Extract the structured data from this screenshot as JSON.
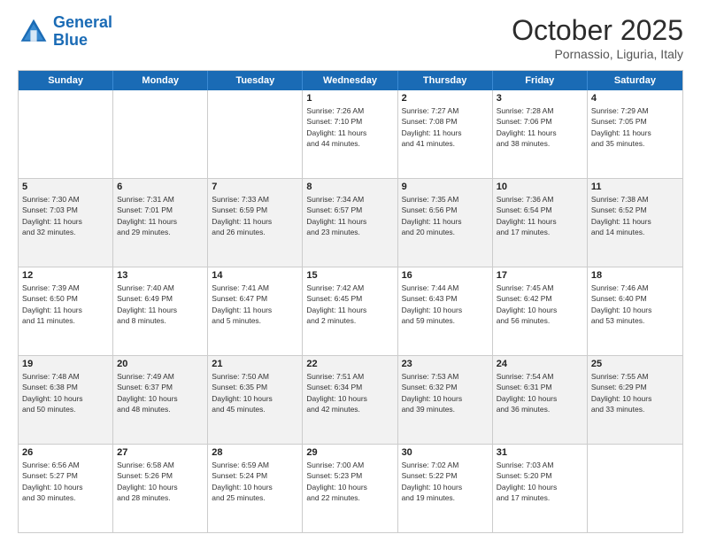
{
  "header": {
    "logo_general": "General",
    "logo_blue": "Blue",
    "month": "October 2025",
    "location": "Pornassio, Liguria, Italy"
  },
  "days_of_week": [
    "Sunday",
    "Monday",
    "Tuesday",
    "Wednesday",
    "Thursday",
    "Friday",
    "Saturday"
  ],
  "rows": [
    {
      "alt": false,
      "cells": [
        {
          "day": "",
          "lines": []
        },
        {
          "day": "",
          "lines": []
        },
        {
          "day": "",
          "lines": []
        },
        {
          "day": "1",
          "lines": [
            "Sunrise: 7:26 AM",
            "Sunset: 7:10 PM",
            "Daylight: 11 hours",
            "and 44 minutes."
          ]
        },
        {
          "day": "2",
          "lines": [
            "Sunrise: 7:27 AM",
            "Sunset: 7:08 PM",
            "Daylight: 11 hours",
            "and 41 minutes."
          ]
        },
        {
          "day": "3",
          "lines": [
            "Sunrise: 7:28 AM",
            "Sunset: 7:06 PM",
            "Daylight: 11 hours",
            "and 38 minutes."
          ]
        },
        {
          "day": "4",
          "lines": [
            "Sunrise: 7:29 AM",
            "Sunset: 7:05 PM",
            "Daylight: 11 hours",
            "and 35 minutes."
          ]
        }
      ]
    },
    {
      "alt": true,
      "cells": [
        {
          "day": "5",
          "lines": [
            "Sunrise: 7:30 AM",
            "Sunset: 7:03 PM",
            "Daylight: 11 hours",
            "and 32 minutes."
          ]
        },
        {
          "day": "6",
          "lines": [
            "Sunrise: 7:31 AM",
            "Sunset: 7:01 PM",
            "Daylight: 11 hours",
            "and 29 minutes."
          ]
        },
        {
          "day": "7",
          "lines": [
            "Sunrise: 7:33 AM",
            "Sunset: 6:59 PM",
            "Daylight: 11 hours",
            "and 26 minutes."
          ]
        },
        {
          "day": "8",
          "lines": [
            "Sunrise: 7:34 AM",
            "Sunset: 6:57 PM",
            "Daylight: 11 hours",
            "and 23 minutes."
          ]
        },
        {
          "day": "9",
          "lines": [
            "Sunrise: 7:35 AM",
            "Sunset: 6:56 PM",
            "Daylight: 11 hours",
            "and 20 minutes."
          ]
        },
        {
          "day": "10",
          "lines": [
            "Sunrise: 7:36 AM",
            "Sunset: 6:54 PM",
            "Daylight: 11 hours",
            "and 17 minutes."
          ]
        },
        {
          "day": "11",
          "lines": [
            "Sunrise: 7:38 AM",
            "Sunset: 6:52 PM",
            "Daylight: 11 hours",
            "and 14 minutes."
          ]
        }
      ]
    },
    {
      "alt": false,
      "cells": [
        {
          "day": "12",
          "lines": [
            "Sunrise: 7:39 AM",
            "Sunset: 6:50 PM",
            "Daylight: 11 hours",
            "and 11 minutes."
          ]
        },
        {
          "day": "13",
          "lines": [
            "Sunrise: 7:40 AM",
            "Sunset: 6:49 PM",
            "Daylight: 11 hours",
            "and 8 minutes."
          ]
        },
        {
          "day": "14",
          "lines": [
            "Sunrise: 7:41 AM",
            "Sunset: 6:47 PM",
            "Daylight: 11 hours",
            "and 5 minutes."
          ]
        },
        {
          "day": "15",
          "lines": [
            "Sunrise: 7:42 AM",
            "Sunset: 6:45 PM",
            "Daylight: 11 hours",
            "and 2 minutes."
          ]
        },
        {
          "day": "16",
          "lines": [
            "Sunrise: 7:44 AM",
            "Sunset: 6:43 PM",
            "Daylight: 10 hours",
            "and 59 minutes."
          ]
        },
        {
          "day": "17",
          "lines": [
            "Sunrise: 7:45 AM",
            "Sunset: 6:42 PM",
            "Daylight: 10 hours",
            "and 56 minutes."
          ]
        },
        {
          "day": "18",
          "lines": [
            "Sunrise: 7:46 AM",
            "Sunset: 6:40 PM",
            "Daylight: 10 hours",
            "and 53 minutes."
          ]
        }
      ]
    },
    {
      "alt": true,
      "cells": [
        {
          "day": "19",
          "lines": [
            "Sunrise: 7:48 AM",
            "Sunset: 6:38 PM",
            "Daylight: 10 hours",
            "and 50 minutes."
          ]
        },
        {
          "day": "20",
          "lines": [
            "Sunrise: 7:49 AM",
            "Sunset: 6:37 PM",
            "Daylight: 10 hours",
            "and 48 minutes."
          ]
        },
        {
          "day": "21",
          "lines": [
            "Sunrise: 7:50 AM",
            "Sunset: 6:35 PM",
            "Daylight: 10 hours",
            "and 45 minutes."
          ]
        },
        {
          "day": "22",
          "lines": [
            "Sunrise: 7:51 AM",
            "Sunset: 6:34 PM",
            "Daylight: 10 hours",
            "and 42 minutes."
          ]
        },
        {
          "day": "23",
          "lines": [
            "Sunrise: 7:53 AM",
            "Sunset: 6:32 PM",
            "Daylight: 10 hours",
            "and 39 minutes."
          ]
        },
        {
          "day": "24",
          "lines": [
            "Sunrise: 7:54 AM",
            "Sunset: 6:31 PM",
            "Daylight: 10 hours",
            "and 36 minutes."
          ]
        },
        {
          "day": "25",
          "lines": [
            "Sunrise: 7:55 AM",
            "Sunset: 6:29 PM",
            "Daylight: 10 hours",
            "and 33 minutes."
          ]
        }
      ]
    },
    {
      "alt": false,
      "cells": [
        {
          "day": "26",
          "lines": [
            "Sunrise: 6:56 AM",
            "Sunset: 5:27 PM",
            "Daylight: 10 hours",
            "and 30 minutes."
          ]
        },
        {
          "day": "27",
          "lines": [
            "Sunrise: 6:58 AM",
            "Sunset: 5:26 PM",
            "Daylight: 10 hours",
            "and 28 minutes."
          ]
        },
        {
          "day": "28",
          "lines": [
            "Sunrise: 6:59 AM",
            "Sunset: 5:24 PM",
            "Daylight: 10 hours",
            "and 25 minutes."
          ]
        },
        {
          "day": "29",
          "lines": [
            "Sunrise: 7:00 AM",
            "Sunset: 5:23 PM",
            "Daylight: 10 hours",
            "and 22 minutes."
          ]
        },
        {
          "day": "30",
          "lines": [
            "Sunrise: 7:02 AM",
            "Sunset: 5:22 PM",
            "Daylight: 10 hours",
            "and 19 minutes."
          ]
        },
        {
          "day": "31",
          "lines": [
            "Sunrise: 7:03 AM",
            "Sunset: 5:20 PM",
            "Daylight: 10 hours",
            "and 17 minutes."
          ]
        },
        {
          "day": "",
          "lines": []
        }
      ]
    }
  ]
}
